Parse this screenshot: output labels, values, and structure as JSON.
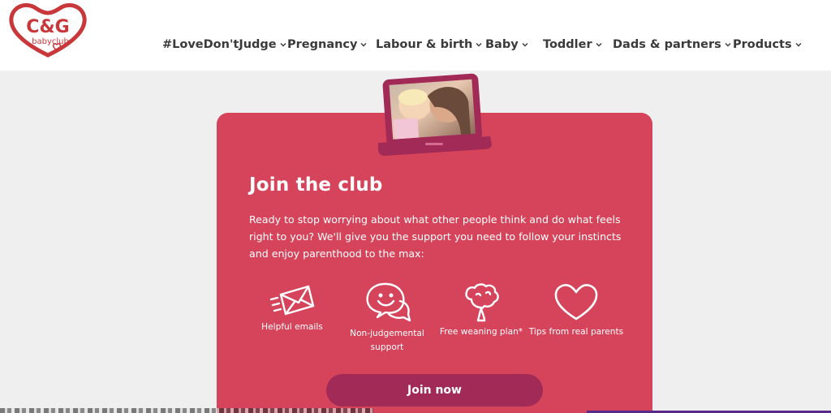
{
  "brand": {
    "logo_text": "C&G",
    "logo_subtext": "babyclub",
    "color": "#c8373a"
  },
  "nav": {
    "items": [
      {
        "label": "#LoveDon'tJudge"
      },
      {
        "label": "Pregnancy"
      },
      {
        "label": "Labour & birth"
      },
      {
        "label": "Baby"
      },
      {
        "label": "Toddler"
      },
      {
        "label": "Dads & partners"
      },
      {
        "label": "Products"
      }
    ]
  },
  "card": {
    "title": "Join the club",
    "body": "Ready to stop worrying about what other people think and do what feels right to you? We'll give you the support you need to follow your instincts and enjoy parenthood to the max:",
    "background": "#d5445a",
    "features": [
      {
        "icon": "envelope-icon",
        "label": "Helpful emails"
      },
      {
        "icon": "chat-smile-icon",
        "label": "Non-judgemental support"
      },
      {
        "icon": "broccoli-icon",
        "label": "Free weaning plan*"
      },
      {
        "icon": "heart-icon",
        "label": "Tips from real parents"
      }
    ],
    "button_label": "Join now",
    "button_color": "#a12a57"
  },
  "laptop_image": {
    "icon": "laptop-photo-image"
  }
}
